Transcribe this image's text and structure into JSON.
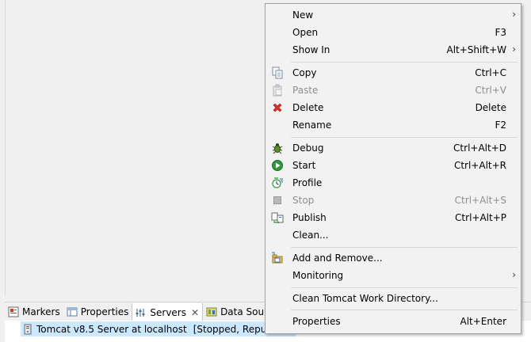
{
  "view_tabs": [
    {
      "label": "Markers",
      "icon": "markers-icon"
    },
    {
      "label": "Properties",
      "icon": "properties-icon"
    },
    {
      "label": "Servers",
      "icon": "servers-icon",
      "active": true
    },
    {
      "label": "Data Source",
      "icon": "data-source-icon"
    }
  ],
  "server": {
    "name": "Tomcat v8.5 Server at localhost",
    "status": "[Stopped, Republish]"
  },
  "menu": {
    "new": {
      "label": "New",
      "shortcut": ""
    },
    "open": {
      "label": "Open",
      "shortcut": "F3"
    },
    "show_in": {
      "label": "Show In",
      "shortcut": "Alt+Shift+W"
    },
    "copy": {
      "label": "Copy",
      "shortcut": "Ctrl+C"
    },
    "paste": {
      "label": "Paste",
      "shortcut": "Ctrl+V"
    },
    "delete": {
      "label": "Delete",
      "shortcut": "Delete"
    },
    "rename": {
      "label": "Rename",
      "shortcut": "F2"
    },
    "debug": {
      "label": "Debug",
      "shortcut": "Ctrl+Alt+D"
    },
    "start": {
      "label": "Start",
      "shortcut": "Ctrl+Alt+R"
    },
    "profile": {
      "label": "Profile",
      "shortcut": ""
    },
    "stop": {
      "label": "Stop",
      "shortcut": "Ctrl+Alt+S"
    },
    "publish": {
      "label": "Publish",
      "shortcut": "Ctrl+Alt+P"
    },
    "clean": {
      "label": "Clean...",
      "shortcut": ""
    },
    "add_remove": {
      "label": "Add and Remove...",
      "shortcut": ""
    },
    "monitoring": {
      "label": "Monitoring",
      "shortcut": ""
    },
    "clean_work_dir": {
      "label": "Clean Tomcat Work Directory...",
      "shortcut": ""
    },
    "properties": {
      "label": "Properties",
      "shortcut": "Alt+Enter"
    }
  },
  "colors": {
    "menu_bg": "#f2f2f2",
    "selection": "#cce8ff",
    "disabled_text": "#8e8e8e",
    "delete_red": "#d9302c",
    "start_green": "#2e9a3a"
  }
}
